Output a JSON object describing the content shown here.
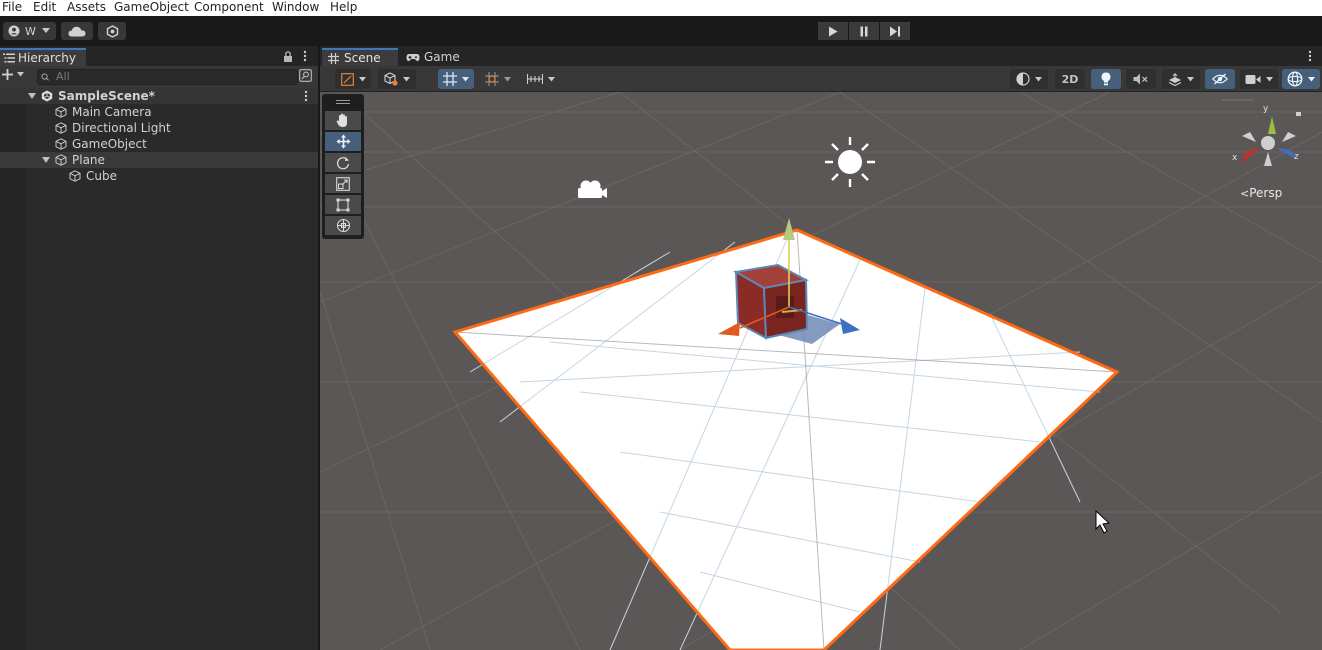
{
  "menu": [
    "File",
    "Edit",
    "Assets",
    "GameObject",
    "Component",
    "Window",
    "Help"
  ],
  "toolbar": {
    "account_label": "W",
    "account_icon": "account-icon",
    "cloud_icon": "cloud-icon",
    "collab_icon": "collab-icon",
    "play_icon": "play-icon",
    "pause_icon": "pause-icon",
    "step_icon": "step-icon"
  },
  "hierarchy": {
    "tab_label": "Hierarchy",
    "search_placeholder": "All",
    "scene_name": "SampleScene*",
    "items": [
      {
        "label": "Main Camera"
      },
      {
        "label": "Directional Light"
      },
      {
        "label": "GameObject"
      },
      {
        "label": "Plane"
      },
      {
        "label": "Cube"
      }
    ]
  },
  "scene": {
    "tabs": [
      "Scene",
      "Game"
    ],
    "btn_2d": "2D",
    "persp_label": "Persp",
    "gizmo_axes": {
      "x": "x",
      "y": "y",
      "z": "z"
    }
  },
  "colors": {
    "selection_outline": "#ff6b14",
    "accent_blue": "#46607c",
    "tab_highlight": "#3a79bb",
    "cube_red": "#8a2b25"
  }
}
